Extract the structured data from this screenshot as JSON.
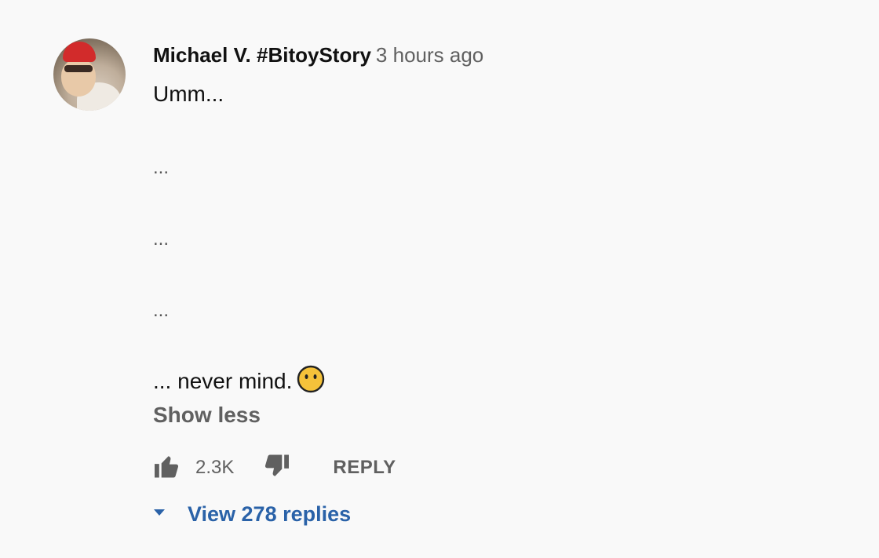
{
  "comment": {
    "author": "Michael V. #BitoyStory",
    "timestamp": "3 hours ago",
    "lines": [
      "Umm...",
      "...",
      "...",
      "...",
      "... never mind."
    ],
    "emoji": "neutral-face-emoji",
    "show_less_label": "Show less",
    "like_count": "2.3K",
    "reply_label": "REPLY",
    "view_replies_label": "View 278 replies"
  },
  "colors": {
    "background": "#f9f9f9",
    "author": "#111111",
    "secondary": "#606060",
    "link": "#2a62a8",
    "emoji": "#f5c23a"
  },
  "icons": {
    "like": "thumbs-up-icon",
    "dislike": "thumbs-down-icon",
    "expand": "caret-down-icon"
  }
}
